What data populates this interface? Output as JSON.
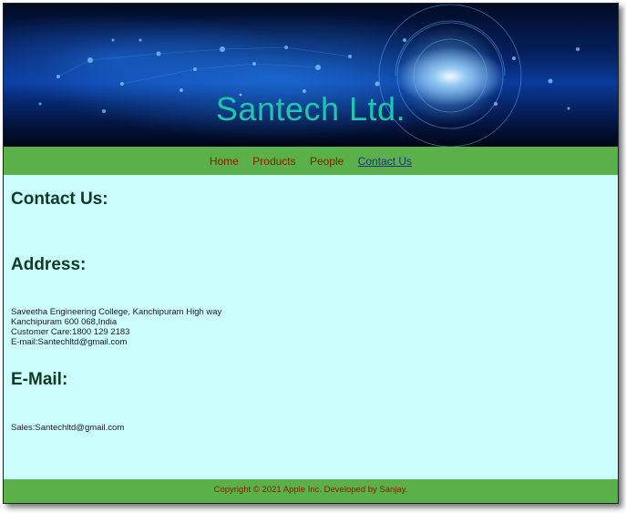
{
  "header": {
    "title": "Santech Ltd."
  },
  "nav": {
    "items": [
      {
        "label": "Home"
      },
      {
        "label": "Products"
      },
      {
        "label": "People"
      },
      {
        "label": "Contact Us"
      }
    ]
  },
  "contact": {
    "heading": "Contact Us:",
    "address_heading": "Address:",
    "address_lines": [
      "Saveetha Engineering College, Kanchipuram High way",
      "Kanchipuram 600 068,India",
      "Customer Care:1800 129 2183",
      "E-mail:Santechltd@gmail.com"
    ],
    "email_heading": "E-Mail:",
    "sales_email": "Sales:Santechltd@gmail.com"
  },
  "footer": {
    "text": "Copyright © 2021 Apple Inc. Developed by Sanjay."
  },
  "colors": {
    "nav_bg": "#5ab149",
    "content_bg": "#ccffff",
    "title": "#1fc6ae",
    "link": "#8b1a00",
    "heading": "#0d3b22"
  }
}
